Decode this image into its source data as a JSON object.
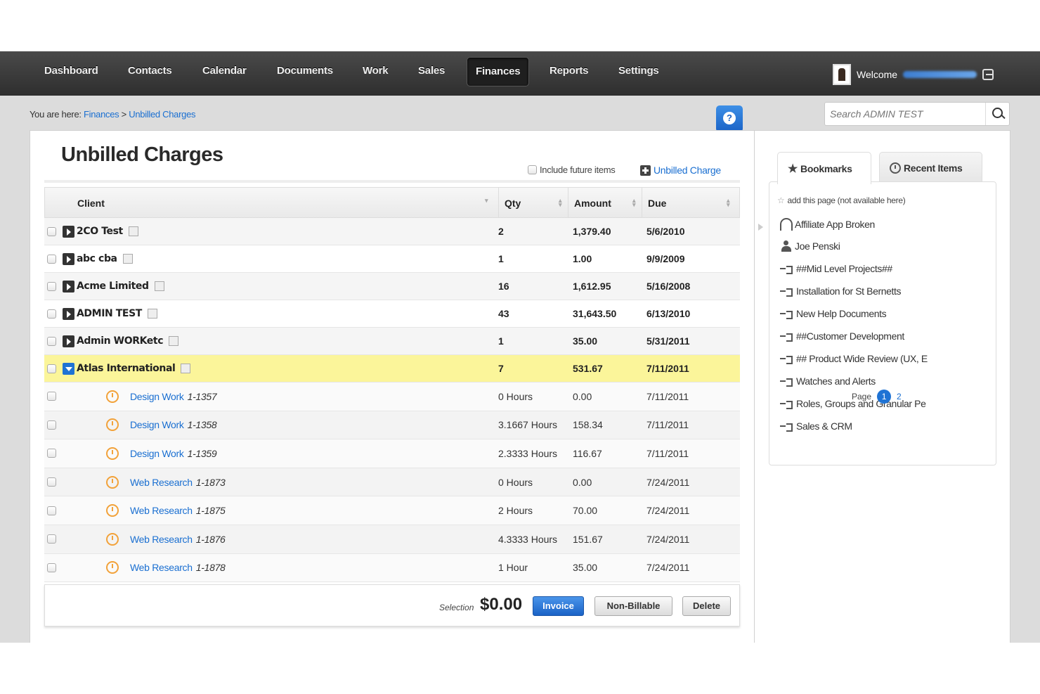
{
  "nav": {
    "items": [
      "Dashboard",
      "Contacts",
      "Calendar",
      "Documents",
      "Work",
      "Sales",
      "Finances",
      "Reports",
      "Settings"
    ],
    "active": "Finances",
    "welcome": "Welcome"
  },
  "breadcrumb": {
    "prefix": "You are here:",
    "items": [
      "Finances",
      "Unbilled Charges"
    ],
    "sep": ">"
  },
  "search": {
    "placeholder": "Search ADMIN TEST"
  },
  "page": {
    "title": "Unbilled Charges",
    "include_future_label": "Include future items",
    "add_charge_label": "Unbilled Charge"
  },
  "table": {
    "headers": [
      "Client",
      "Qty",
      "Amount",
      "Due"
    ],
    "clients": [
      {
        "name": "2CO Test",
        "qty": "2",
        "amount": "1,379.40",
        "due": "5/6/2010"
      },
      {
        "name": "abc cba",
        "qty": "1",
        "amount": "1.00",
        "due": "9/9/2009"
      },
      {
        "name": "Acme Limited",
        "qty": "16",
        "amount": "1,612.95",
        "due": "5/16/2008"
      },
      {
        "name": "ADMIN TEST",
        "qty": "43",
        "amount": "31,643.50",
        "due": "6/13/2010"
      },
      {
        "name": "Admin WORKetc",
        "qty": "1",
        "amount": "35.00",
        "due": "5/31/2011"
      },
      {
        "name": "Atlas International",
        "qty": "7",
        "amount": "531.67",
        "due": "7/11/2011"
      }
    ],
    "items": [
      {
        "name": "Design Work",
        "num": "1-1357",
        "qty": "0 Hours",
        "amount": "0.00",
        "due": "7/11/2011"
      },
      {
        "name": "Design Work",
        "num": "1-1358",
        "qty": "3.1667 Hours",
        "amount": "158.34",
        "due": "7/11/2011"
      },
      {
        "name": "Design Work",
        "num": "1-1359",
        "qty": "2.3333 Hours",
        "amount": "116.67",
        "due": "7/11/2011"
      },
      {
        "name": "Web Research",
        "num": "1-1873",
        "qty": "0 Hours",
        "amount": "0.00",
        "due": "7/24/2011"
      },
      {
        "name": "Web Research",
        "num": "1-1875",
        "qty": "2 Hours",
        "amount": "70.00",
        "due": "7/24/2011"
      },
      {
        "name": "Web Research",
        "num": "1-1876",
        "qty": "4.3333 Hours",
        "amount": "151.67",
        "due": "7/24/2011"
      },
      {
        "name": "Web Research",
        "num": "1-1878",
        "qty": "1 Hour",
        "amount": "35.00",
        "due": "7/24/2011"
      }
    ]
  },
  "footer": {
    "selection_label": "Selection",
    "selection_amount": "$0.00",
    "invoice": "Invoice",
    "non_billable": "Non-Billable",
    "delete": "Delete"
  },
  "sidebar": {
    "tab_bookmarks": "Bookmarks",
    "tab_recent": "Recent Items",
    "add_page": "add this page (not available here)",
    "bookmarks": [
      {
        "icon": "headset-icon",
        "label": "Affiliate App Broken"
      },
      {
        "icon": "person-icon",
        "label": "Joe Penski"
      },
      {
        "icon": "project-icon",
        "label": "##Mid Level Projects##"
      },
      {
        "icon": "project-icon",
        "label": "Installation for St Bernetts"
      },
      {
        "icon": "project-icon",
        "label": "New Help Documents"
      },
      {
        "icon": "project-icon",
        "label": "##Customer Development"
      },
      {
        "icon": "project-icon",
        "label": "## Product Wide Review (UX, E"
      },
      {
        "icon": "project-icon",
        "label": "Watches and Alerts"
      },
      {
        "icon": "project-icon",
        "label": "Roles, Groups and Granular Pe"
      },
      {
        "icon": "project-icon",
        "label": "Sales & CRM"
      }
    ],
    "page_label": "Page",
    "pages": [
      "1",
      "2"
    ]
  }
}
